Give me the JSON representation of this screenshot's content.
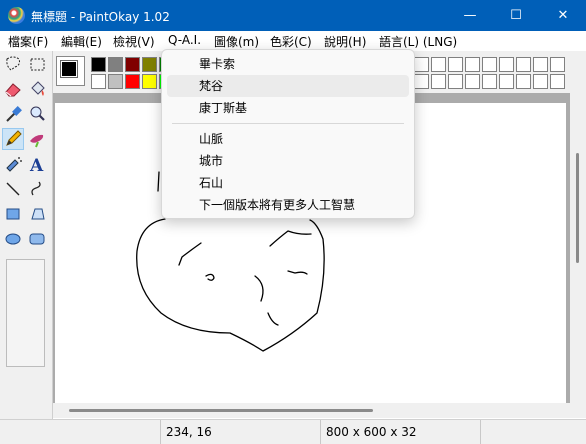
{
  "window": {
    "title": "無標題 - PaintOkay 1.02",
    "minimize_glyph": "—",
    "maximize_glyph": "☐",
    "close_glyph": "✕"
  },
  "menubar": {
    "items": [
      {
        "label": "檔案(F)"
      },
      {
        "label": "編輯(E)"
      },
      {
        "label": "檢視(V)"
      },
      {
        "label": "Q-A.I."
      },
      {
        "label": "圖像(m)"
      },
      {
        "label": "色彩(C)"
      },
      {
        "label": "說明(H)"
      },
      {
        "label": "語言(L) (LNG)"
      }
    ]
  },
  "qai_menu": {
    "items": [
      {
        "label": "畢卡索",
        "highlighted": false
      },
      {
        "label": "梵谷",
        "highlighted": true
      },
      {
        "label": "康丁斯基",
        "highlighted": false
      },
      {
        "label": "山脈",
        "highlighted": false
      },
      {
        "label": "城市",
        "highlighted": false
      },
      {
        "label": "石山",
        "highlighted": false
      },
      {
        "label": "下一個版本將有更多人工智慧",
        "highlighted": false
      }
    ]
  },
  "tools": [
    "free-select",
    "rect-select",
    "eraser",
    "fill-bucket",
    "color-picker",
    "magnifier",
    "pencil",
    "brush",
    "airbrush",
    "text",
    "line",
    "curve",
    "rectangle",
    "polygon",
    "ellipse",
    "rounded-rectangle"
  ],
  "selected_tool": "pencil",
  "palette": {
    "foreground": "#000000",
    "background": "#ffffff",
    "row1": [
      "#000000",
      "#808080",
      "#800000",
      "#808000"
    ],
    "row2": [
      "#ffffff",
      "#c0c0c0",
      "#ff0000",
      "#ffff00"
    ],
    "accent": "#005fb8"
  },
  "status": {
    "coords": "234, 16",
    "dimensions": "800 x 600 x 32"
  }
}
